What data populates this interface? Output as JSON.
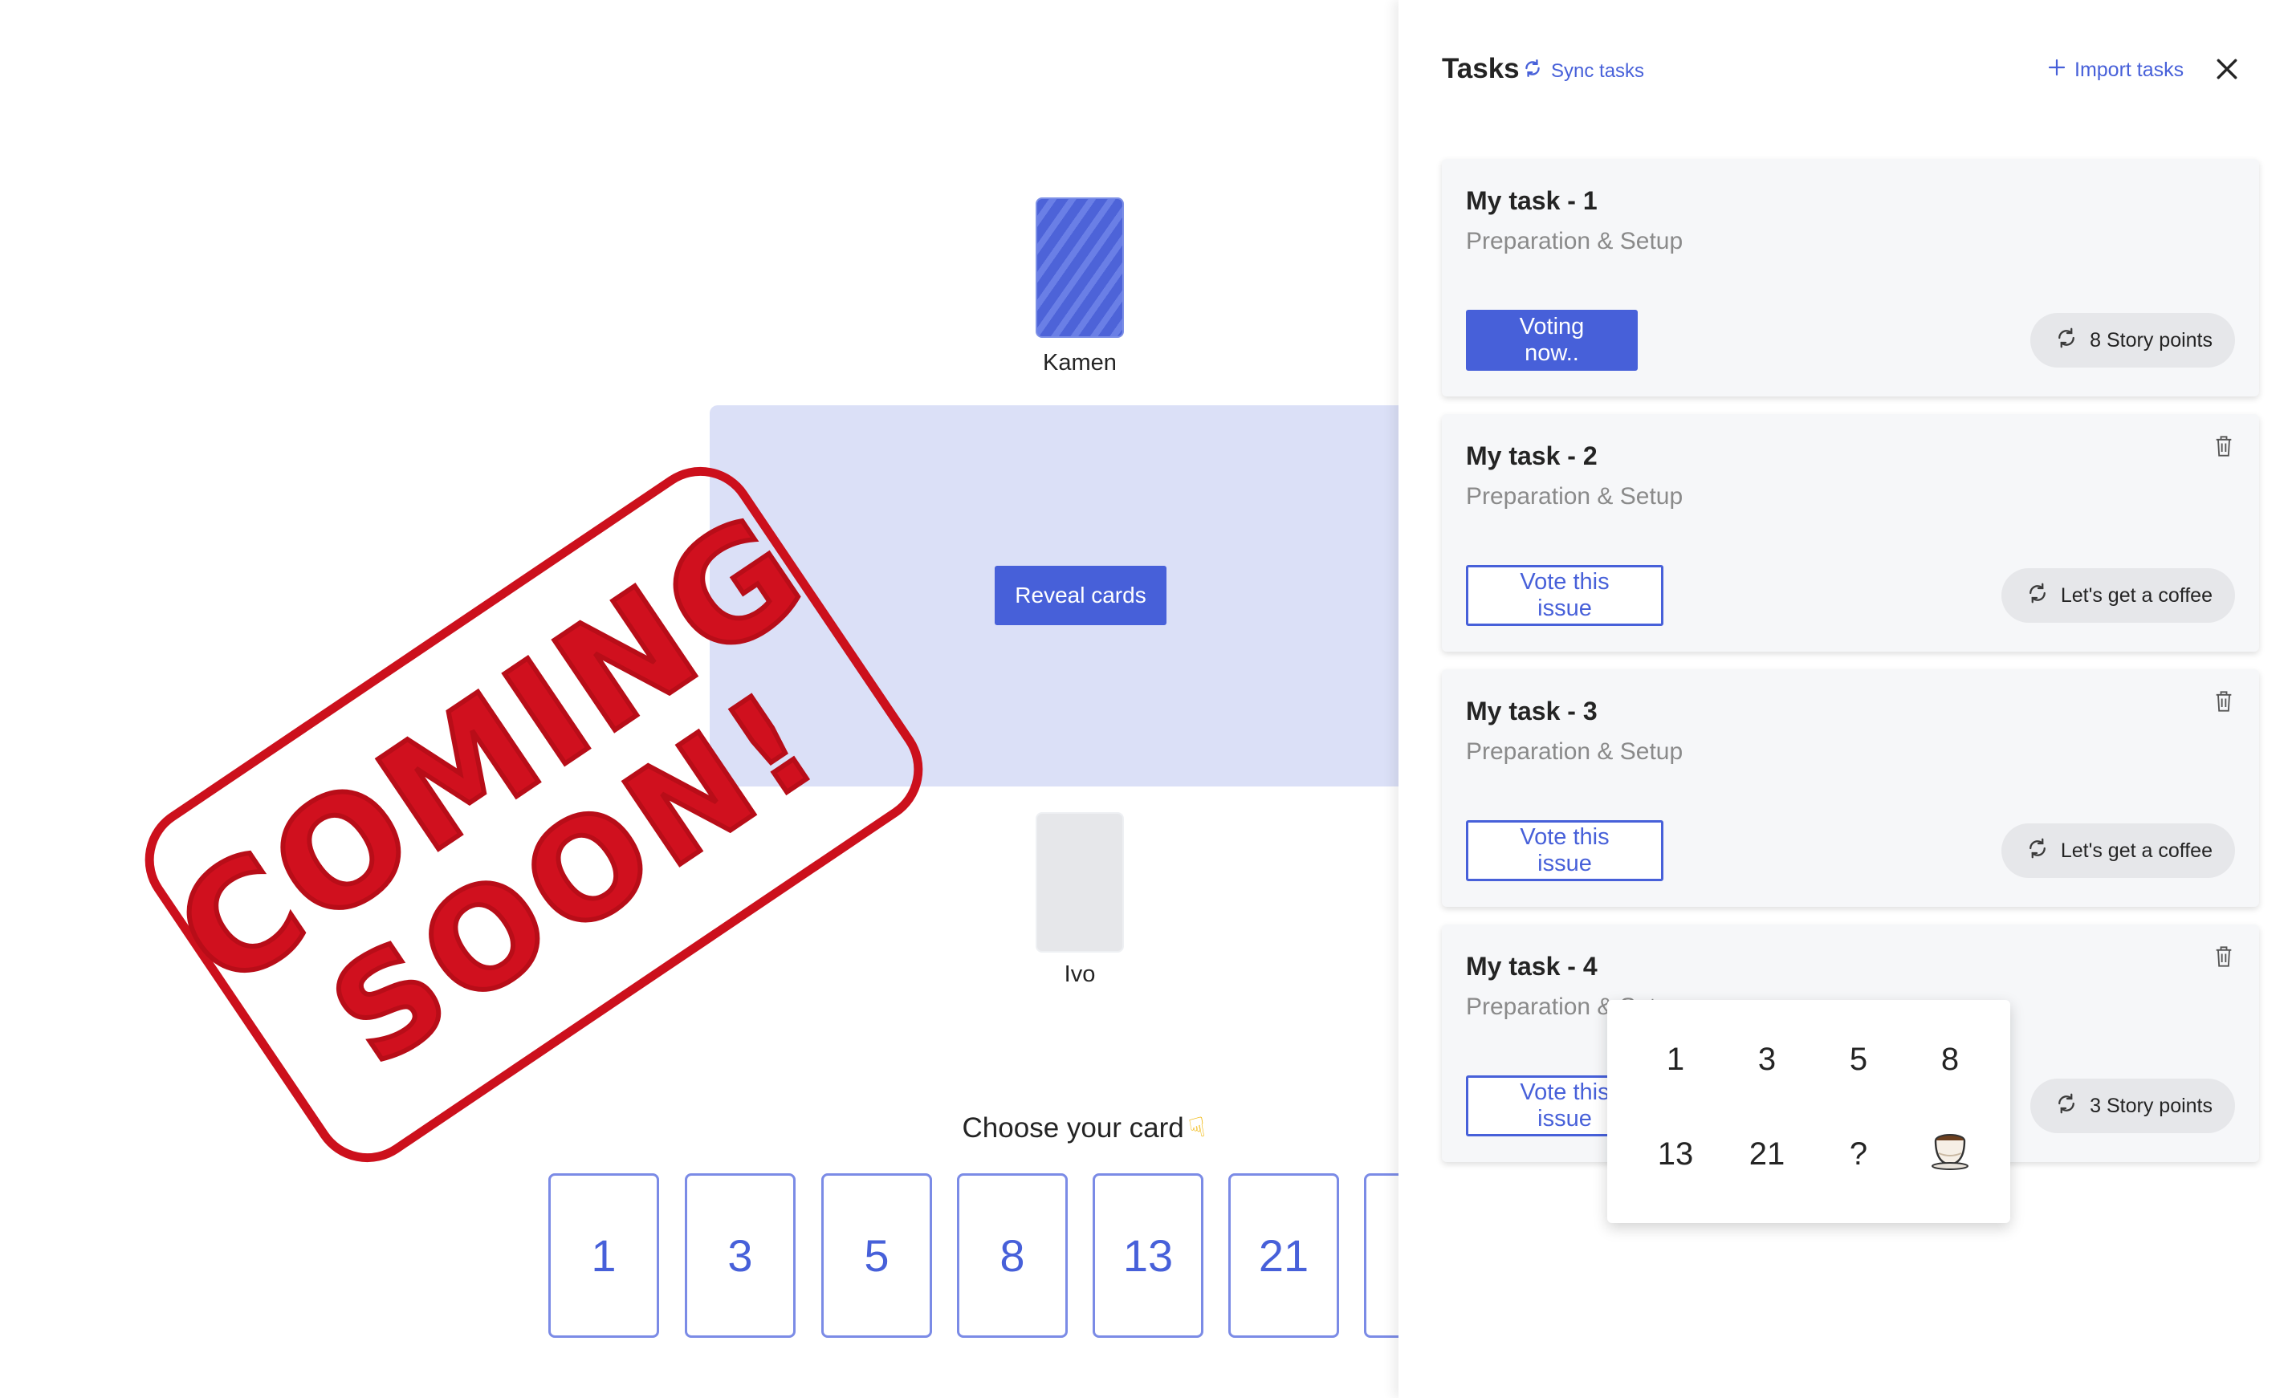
{
  "game": {
    "players": [
      {
        "name": "Kamen",
        "card_state": "face-down"
      },
      {
        "name": "Ivo",
        "card_state": "empty"
      }
    ],
    "reveal_button_label": "Reveal cards",
    "choose_label": "Choose your card",
    "hand_icon": "hand-pointing-down-icon",
    "cards": [
      "1",
      "3",
      "5",
      "8",
      "13",
      "21"
    ]
  },
  "stamp": {
    "line1": "COMING",
    "line2": "SOON!",
    "color": "#cc101c"
  },
  "tasks_panel": {
    "title": "Tasks",
    "sync_label": "Sync tasks",
    "import_label": "Import tasks",
    "accent_color": "#4760d9",
    "tasks": [
      {
        "title": "My task - 1",
        "subtitle": "Preparation & Setup",
        "button": "Voting now..",
        "points": "8 Story points",
        "deletable": false
      },
      {
        "title": "My task - 2",
        "subtitle": "Preparation & Setup",
        "button": "Vote this issue",
        "points": "Let's get a coffee",
        "deletable": true
      },
      {
        "title": "My task - 3",
        "subtitle": "Preparation & Setup",
        "button": "Vote this issue",
        "points": "Let's get a coffee",
        "deletable": true
      },
      {
        "title": "My task - 4",
        "subtitle": "Preparation & Setup",
        "button": "Vote this issue",
        "points": "3 Story points",
        "deletable": true
      }
    ]
  },
  "estimate_menu": {
    "options": [
      "1",
      "3",
      "5",
      "8",
      "13",
      "21",
      "?",
      "coffee-cup-icon"
    ]
  }
}
